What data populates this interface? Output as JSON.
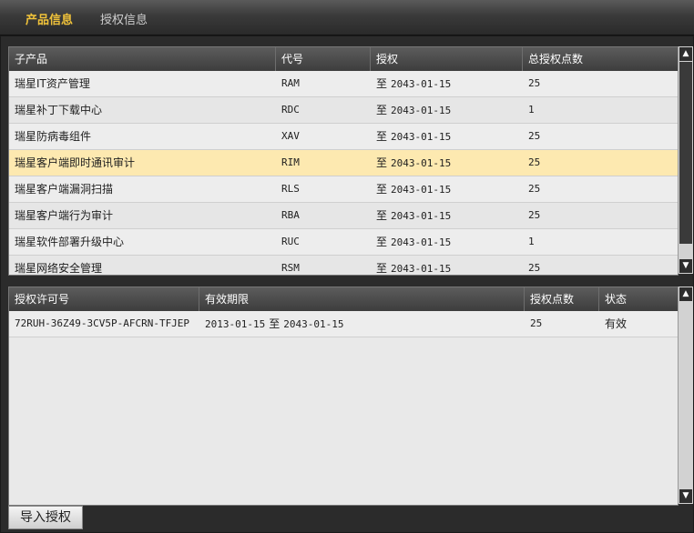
{
  "tabs": [
    {
      "label": "产品信息",
      "active": true
    },
    {
      "label": "授权信息",
      "active": false
    }
  ],
  "products_table": {
    "columns": [
      "子产品",
      "代号",
      "授权",
      "总授权点数"
    ],
    "rows": [
      {
        "name": "瑞星IT资产管理",
        "code": "RAM",
        "auth_prefix": "至",
        "auth_date": "2043-01-15",
        "points": "25"
      },
      {
        "name": "瑞星补丁下载中心",
        "code": "RDC",
        "auth_prefix": "至",
        "auth_date": "2043-01-15",
        "points": "1"
      },
      {
        "name": "瑞星防病毒组件",
        "code": "XAV",
        "auth_prefix": "至",
        "auth_date": "2043-01-15",
        "points": "25"
      },
      {
        "name": "瑞星客户端即时通讯审计",
        "code": "RIM",
        "auth_prefix": "至",
        "auth_date": "2043-01-15",
        "points": "25",
        "highlighted": true
      },
      {
        "name": "瑞星客户端漏洞扫描",
        "code": "RLS",
        "auth_prefix": "至",
        "auth_date": "2043-01-15",
        "points": "25"
      },
      {
        "name": "瑞星客户端行为审计",
        "code": "RBA",
        "auth_prefix": "至",
        "auth_date": "2043-01-15",
        "points": "25"
      },
      {
        "name": "瑞星软件部署升级中心",
        "code": "RUC",
        "auth_prefix": "至",
        "auth_date": "2043-01-15",
        "points": "1"
      },
      {
        "name": "瑞星网络安全管理",
        "code": "RSM",
        "auth_prefix": "至",
        "auth_date": "2043-01-15",
        "points": "25"
      }
    ]
  },
  "license_table": {
    "columns": [
      "授权许可号",
      "有效期限",
      "授权点数",
      "状态"
    ],
    "rows": [
      {
        "license": "72RUH-36Z49-3CV5P-AFCRN-TFJEP",
        "start": "2013-01-15",
        "to": "至",
        "end": "2043-01-15",
        "points": "25",
        "status": "有效"
      }
    ]
  },
  "import_button": {
    "label": "导入授权"
  },
  "colors": {
    "active_tab": "#f0c23a",
    "highlight_row": "#fde9b0"
  }
}
